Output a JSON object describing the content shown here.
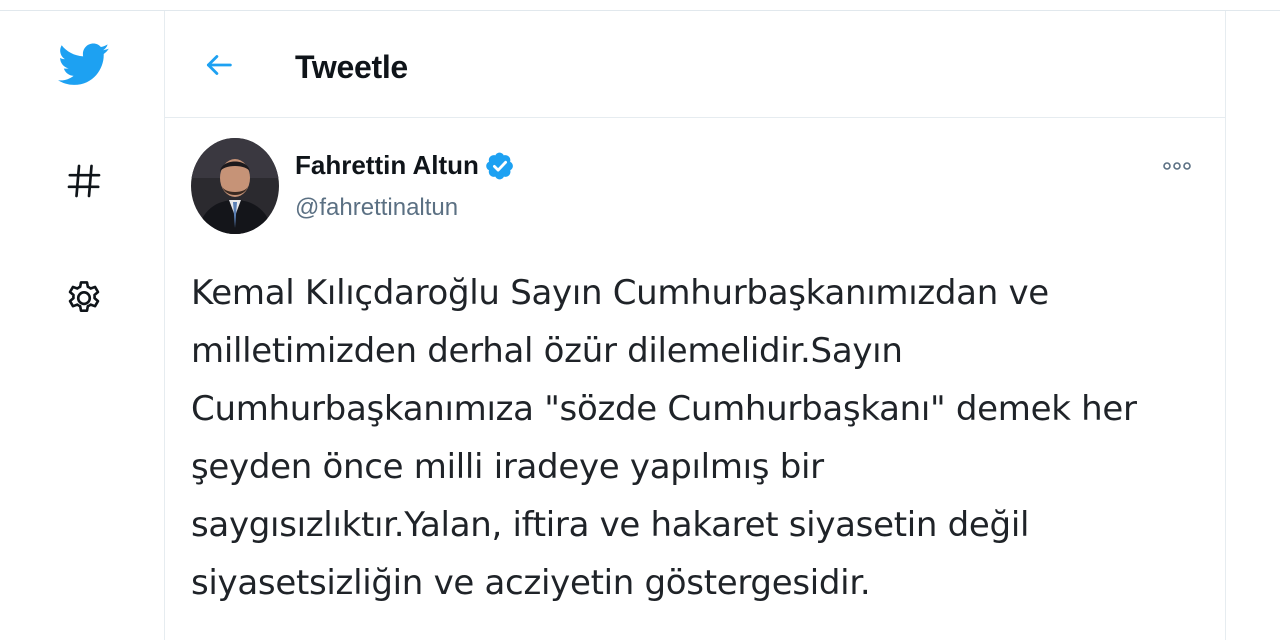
{
  "header": {
    "title": "Tweetle"
  },
  "nav": {
    "items": [
      {
        "icon": "twitter-logo-icon"
      },
      {
        "icon": "hashtag-icon"
      },
      {
        "icon": "gear-icon"
      }
    ]
  },
  "tweet": {
    "author_name": "Fahrettin Altun",
    "author_handle": "@fahrettinaltun",
    "verified": true,
    "text_lines": [
      "Kemal Kılıçdaroğlu Sayın Cumhurbaşkanımızdan ve",
      "milletimizden derhal özür dilemelidir.Sayın",
      "Cumhurbaşkanımıza \"sözde Cumhurbaşkanı\" demek her",
      "şeyden önce milli iradeye yapılmış bir",
      "saygısızlıktır.Yalan, iftira ve hakaret siyasetin değil",
      "siyasetsizliğin ve acziyetin göstergesidir."
    ]
  },
  "colors": {
    "brand_blue": "#1da1f2",
    "text_primary": "#0f1419",
    "text_secondary": "#5b7083",
    "border": "#e6ecf0"
  }
}
